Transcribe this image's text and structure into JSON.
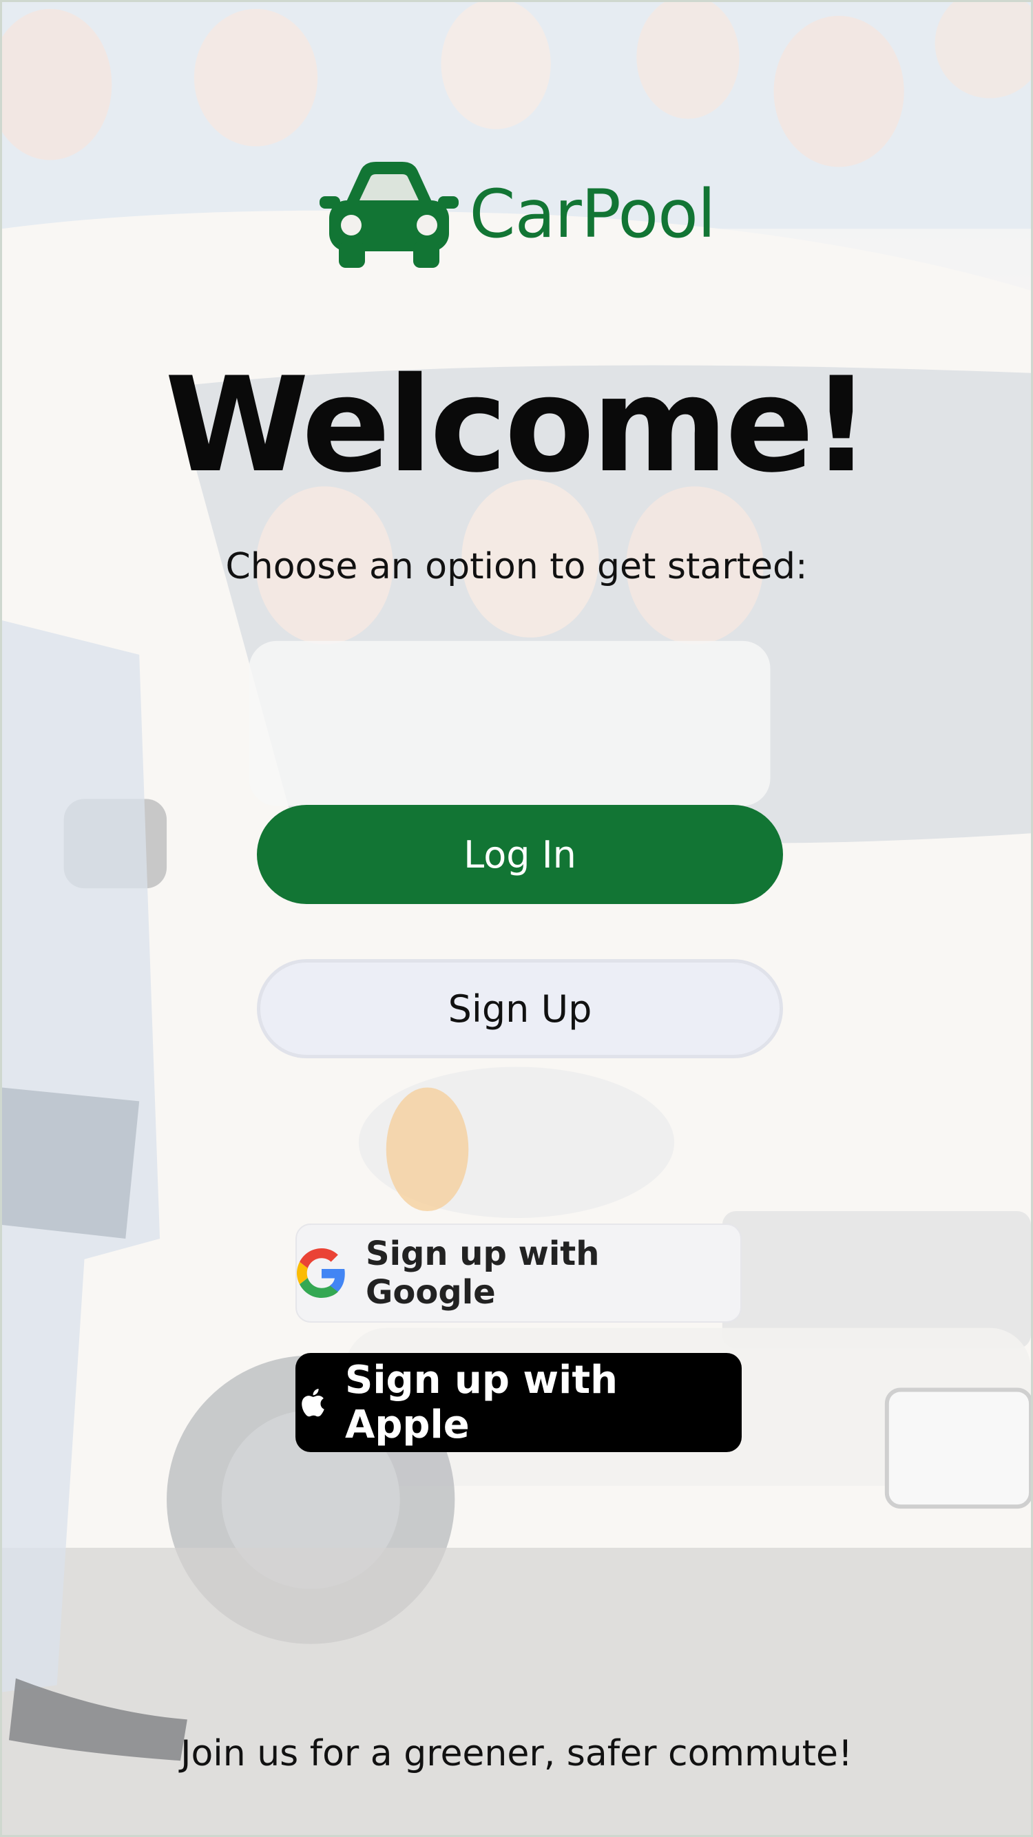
{
  "app": {
    "brand_name": "CarPool",
    "brand_color": "#127534"
  },
  "hero": {
    "title": "Welcome!",
    "subtitle": "Choose an option to get started:"
  },
  "actions": {
    "login_label": "Log In",
    "signup_label": "Sign Up"
  },
  "social": {
    "google_label": "Sign up with Google",
    "apple_label": "Sign up with Apple"
  },
  "footer": {
    "tagline": "Join us for a greener, safer commute!"
  },
  "icons": {
    "brand": "car-icon",
    "google": "google-icon",
    "apple": "apple-icon"
  }
}
